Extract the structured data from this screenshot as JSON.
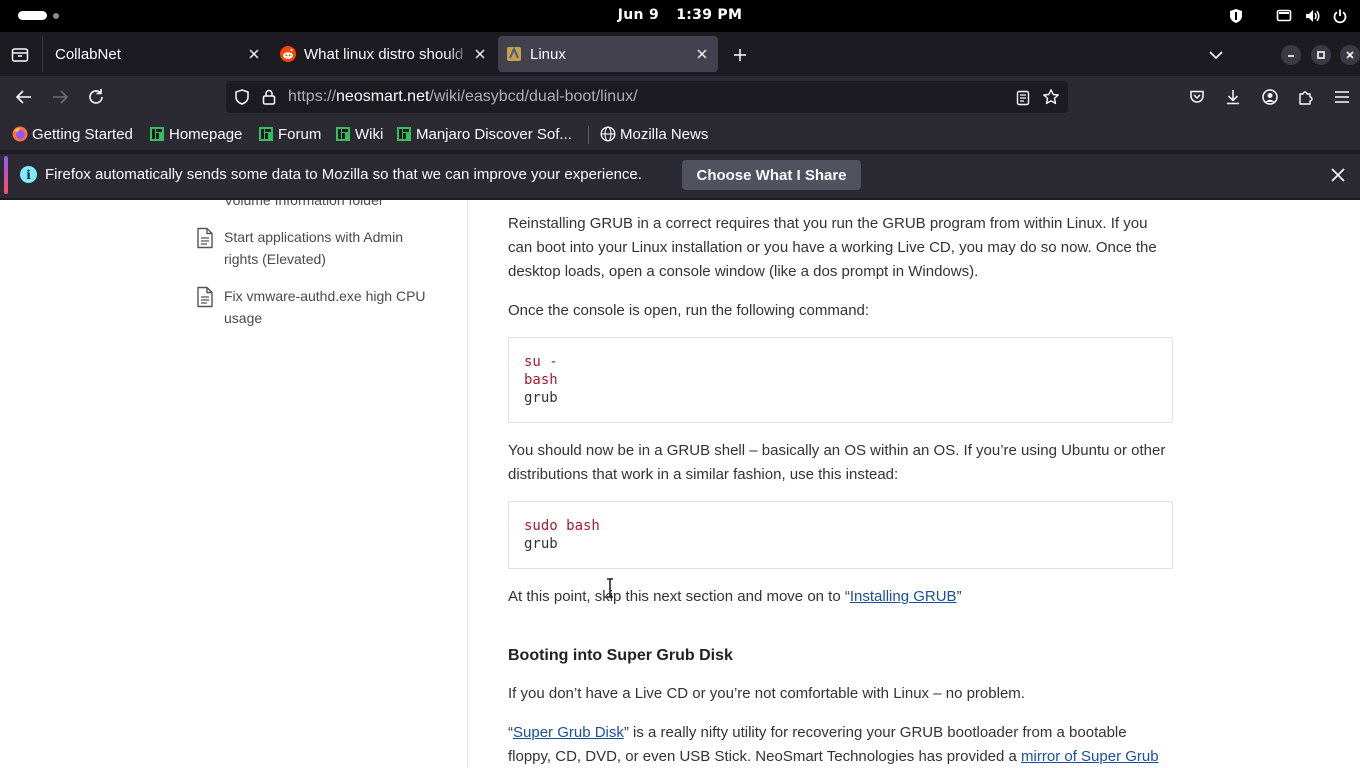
{
  "system": {
    "date": "Jun 9",
    "time": "1:39 PM"
  },
  "tabs": [
    {
      "label": "CollabNet",
      "active": false
    },
    {
      "label": "What linux distro should",
      "active": false
    },
    {
      "label": "Linux",
      "active": true
    }
  ],
  "navbar": {
    "url_prefix": "https://",
    "url_host": "neosmart.net",
    "url_path": "/wiki/easybcd/dual-boot/linux/"
  },
  "bookmarks": [
    {
      "label": "Getting Started"
    },
    {
      "label": "Homepage"
    },
    {
      "label": "Forum"
    },
    {
      "label": "Wiki"
    },
    {
      "label": "Manjaro Discover Sof..."
    },
    {
      "label": "Mozilla News"
    }
  ],
  "notification": {
    "message": "Firefox automatically sends some data to Mozilla so that we can improve your experience.",
    "button": "Choose What I Share"
  },
  "sidebar": {
    "clipped_item": "Volume Information folder",
    "items": [
      {
        "label": "Start applications with Admin rights (Elevated)"
      },
      {
        "label": "Fix vmware-authd.exe high CPU usage"
      }
    ]
  },
  "article": {
    "p1": "Reinstalling GRUB in a correct requires that you run the GRUB program from within Linux. If you can boot into your Linux installation or you have a working Live CD, you may do so now. Once the desktop loads, open a console window (like a dos prompt in Windows).",
    "p2": "Once the console is open, run the following command:",
    "code1": {
      "l1": "su -",
      "l2": "bash",
      "l3": "grub"
    },
    "p3": "You should now be in a GRUB shell – basically an OS within an OS. If you’re using Ubuntu or other distributions that work in a similar fashion, use this instead:",
    "code2": {
      "l1": "sudo bash",
      "l2": "grub"
    },
    "p4_before": "At this point, skip this next section and move on to “",
    "p4_link": "Installing GRUB",
    "p4_after": "”",
    "heading": "Booting into Super Grub Disk",
    "p5": "If you don’t have a Live CD or you’re not comfortable with Linux – no problem.",
    "p6_open": "“",
    "p6_link1": "Super Grub Disk",
    "p6_mid": "” is a really nifty utility for recovering your GRUB bootloader from a bootable floppy, CD, DVD, or even USB Stick. NeoSmart Technologies has provided a ",
    "p6_link2": "mirror of Super Grub"
  }
}
